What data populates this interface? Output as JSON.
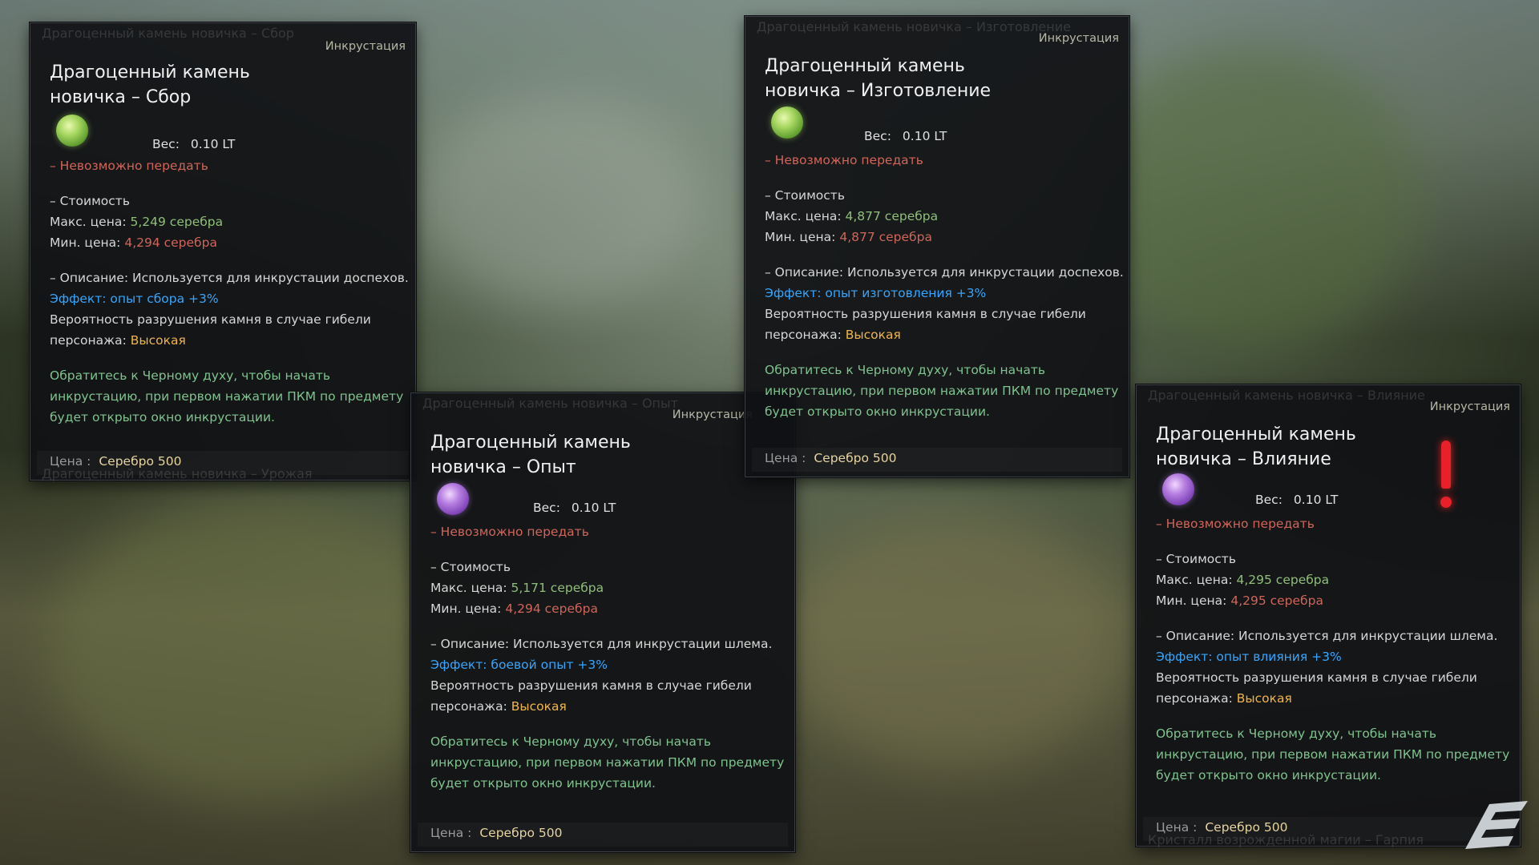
{
  "background": {
    "watermark_icon": "brand-logo-icon",
    "alert_icon": "exclamation-icon",
    "alert_color": "#e8202a"
  },
  "cards": [
    {
      "ghost_top": "Драгоценный камень новичка – Сбор",
      "ghost_bottom": "Драгоценный камень новичка – Урожая",
      "tag": "Инкрустация",
      "title_line1": "Драгоценный камень",
      "title_line2": "новичка – Сбор",
      "gem_color": "green",
      "weight_label": "Вес:",
      "weight_value": "0.10 LT",
      "no_transfer": "– Невозможно передать",
      "cost_header": "– Стоимость",
      "max_label": "Макс. цена:",
      "max_value": "5,249 серебра",
      "min_label": "Мин. цена:",
      "min_value": "4,294 серебра",
      "desc_prefix": "– Описание: Используется для инкрустации",
      "desc_target": "доспехов.",
      "effect": "Эффект: опыт сбора +3%",
      "break_line1": "Вероятность разрушения камня в случае гибели",
      "break_line2_prefix": "персонажа:",
      "break_level": "Высокая",
      "hint_line1": "Обратитесь к Черному духу, чтобы начать",
      "hint_line2": "инкрустацию, при первом нажатии ПКМ по предмету",
      "hint_line3": "будет открыто окно инкрустации.",
      "price_label": "Цена :",
      "price_value": "Серебро 500"
    },
    {
      "ghost_top": "Драгоценный камень новичка – Опыт",
      "ghost_bottom": "",
      "tag": "Инкрустация",
      "title_line1": "Драгоценный камень",
      "title_line2": "новичка – Опыт",
      "gem_color": "purple",
      "weight_label": "Вес:",
      "weight_value": "0.10 LT",
      "no_transfer": "– Невозможно передать",
      "cost_header": "– Стоимость",
      "max_label": "Макс. цена:",
      "max_value": "5,171 серебра",
      "min_label": "Мин. цена:",
      "min_value": "4,294 серебра",
      "desc_prefix": "– Описание: Используется для инкрустации",
      "desc_target": "шлема.",
      "effect": "Эффект: боевой опыт +3%",
      "break_line1": "Вероятность разрушения камня в случае гибели",
      "break_line2_prefix": "персонажа:",
      "break_level": "Высокая",
      "hint_line1": "Обратитесь к Черному духу, чтобы начать",
      "hint_line2": "инкрустацию, при первом нажатии ПКМ по предмету",
      "hint_line3": "будет открыто окно инкрустации.",
      "price_label": "Цена :",
      "price_value": "Серебро 500"
    },
    {
      "ghost_top": "Драгоценный камень новичка – Изготовление",
      "ghost_bottom": "",
      "tag": "Инкрустация",
      "title_line1": "Драгоценный камень",
      "title_line2": "новичка – Изготовление",
      "gem_color": "green",
      "weight_label": "Вес:",
      "weight_value": "0.10 LT",
      "no_transfer": "– Невозможно передать",
      "cost_header": "– Стоимость",
      "max_label": "Макс. цена:",
      "max_value": "4,877 серебра",
      "min_label": "Мин. цена:",
      "min_value": "4,877 серебра",
      "desc_prefix": "– Описание: Используется для инкрустации",
      "desc_target": "доспехов.",
      "effect": "Эффект: опыт изготовления +3%",
      "break_line1": "Вероятность разрушения камня в случае гибели",
      "break_line2_prefix": "персонажа:",
      "break_level": "Высокая",
      "hint_line1": "Обратитесь к Черному духу, чтобы начать",
      "hint_line2": "инкрустацию, при первом нажатии ПКМ по предмету",
      "hint_line3": "будет открыто окно инкрустации.",
      "price_label": "Цена :",
      "price_value": "Серебро 500"
    },
    {
      "ghost_top": "Драгоценный камень новичка – Влияние",
      "ghost_bottom": "Кристалл возрожденной магии – Гарпия",
      "tag": "Инкрустация",
      "title_line1": "Драгоценный камень",
      "title_line2": "новичка – Влияние",
      "gem_color": "purple",
      "weight_label": "Вес:",
      "weight_value": "0.10 LT",
      "no_transfer": "– Невозможно передать",
      "cost_header": "– Стоимость",
      "max_label": "Макс. цена:",
      "max_value": "4,295 серебра",
      "min_label": "Мин. цена:",
      "min_value": "4,295 серебра",
      "desc_prefix": "– Описание: Используется для инкрустации",
      "desc_target": "шлема.",
      "effect": "Эффект: опыт влияния +3%",
      "break_line1": "Вероятность разрушения камня в случае гибели",
      "break_line2_prefix": "персонажа:",
      "break_level": "Высокая",
      "hint_line1": "Обратитесь к Черному духу, чтобы начать",
      "hint_line2": "инкрустацию, при первом нажатии ПКМ по предмету",
      "hint_line3": "будет открыто окно инкрустации.",
      "price_label": "Цена :",
      "price_value": "Серебро 500"
    }
  ]
}
